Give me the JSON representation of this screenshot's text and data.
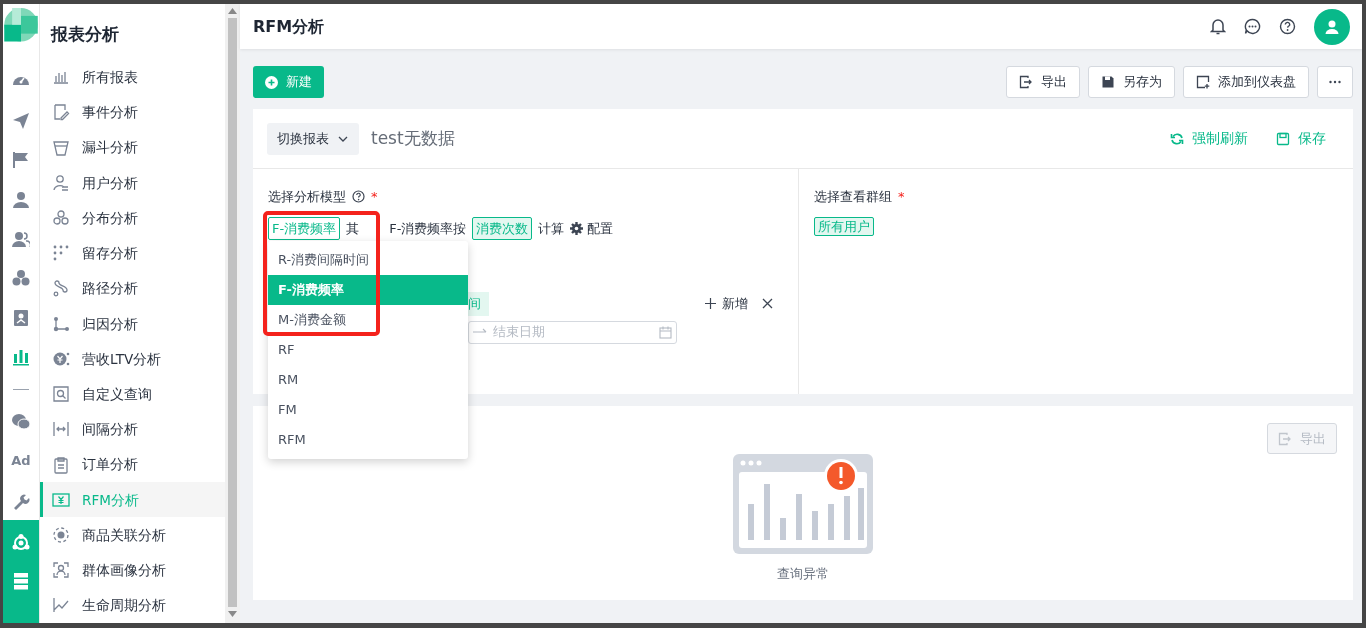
{
  "rail": [
    {
      "kind": "icon",
      "selected": false
    },
    {
      "kind": "icon",
      "selected": false
    },
    {
      "kind": "icon",
      "selected": false
    },
    {
      "kind": "icon",
      "selected": false
    },
    {
      "kind": "icon",
      "selected": false
    },
    {
      "kind": "icon",
      "selected": false
    },
    {
      "kind": "icon",
      "selected": false
    },
    {
      "kind": "icon",
      "selected": true
    },
    {
      "kind": "icon",
      "selected": false
    },
    {
      "kind": "text",
      "label": "Ad",
      "selected": false
    },
    {
      "kind": "icon",
      "selected": false
    }
  ],
  "sidebar": {
    "title": "报表分析",
    "items": [
      {
        "label": "所有报表",
        "selected": false
      },
      {
        "label": "事件分析",
        "selected": false
      },
      {
        "label": "漏斗分析",
        "selected": false
      },
      {
        "label": "用户分析",
        "selected": false
      },
      {
        "label": "分布分析",
        "selected": false
      },
      {
        "label": "留存分析",
        "selected": false
      },
      {
        "label": "路径分析",
        "selected": false
      },
      {
        "label": "归因分析",
        "selected": false
      },
      {
        "label": "营收LTV分析",
        "selected": false
      },
      {
        "label": "自定义查询",
        "selected": false
      },
      {
        "label": "间隔分析",
        "selected": false
      },
      {
        "label": "订单分析",
        "selected": false
      },
      {
        "label": "RFM分析",
        "selected": true
      },
      {
        "label": "商品关联分析",
        "selected": false
      },
      {
        "label": "群体画像分析",
        "selected": false
      },
      {
        "label": "生命周期分析",
        "selected": false
      }
    ]
  },
  "header": {
    "title": "RFM分析"
  },
  "toolbar": {
    "new_button": "新建",
    "buttons": [
      "导出",
      "另存为",
      "添加到仪表盘"
    ]
  },
  "report": {
    "switch_label": "切换报表",
    "name": "test无数据",
    "actions": [
      "强制刷新",
      "保存"
    ]
  },
  "model": {
    "label": "选择分析模型",
    "required_mark": "*",
    "sentence": [
      {
        "kind": "tag",
        "text": "F-消费频率"
      },
      {
        "kind": "text",
        "text": "其"
      },
      {
        "kind": "text",
        "text": "F-消费频率按"
      },
      {
        "kind": "tag",
        "text": "消费次数"
      },
      {
        "kind": "text",
        "text": "计算"
      },
      {
        "kind": "link",
        "text": "配置"
      }
    ]
  },
  "dropdown": {
    "options": [
      {
        "label": "R-消费间隔时间",
        "selected": false
      },
      {
        "label": "F-消费频率",
        "selected": true
      },
      {
        "label": "M-消费金额",
        "selected": false
      },
      {
        "label": "RF",
        "selected": false
      },
      {
        "label": "RM",
        "selected": false
      },
      {
        "label": "FM",
        "selected": false
      },
      {
        "label": "RFM",
        "selected": false
      }
    ]
  },
  "range": {
    "tag": "间",
    "add": "新增",
    "end_placeholder": "结束日期"
  },
  "group": {
    "label": "选择查看群组",
    "required_mark": "*",
    "tag": "所有用户"
  },
  "result": {
    "export_button": {
      "label": "导出",
      "disabled": true
    },
    "message": "查询异常"
  }
}
